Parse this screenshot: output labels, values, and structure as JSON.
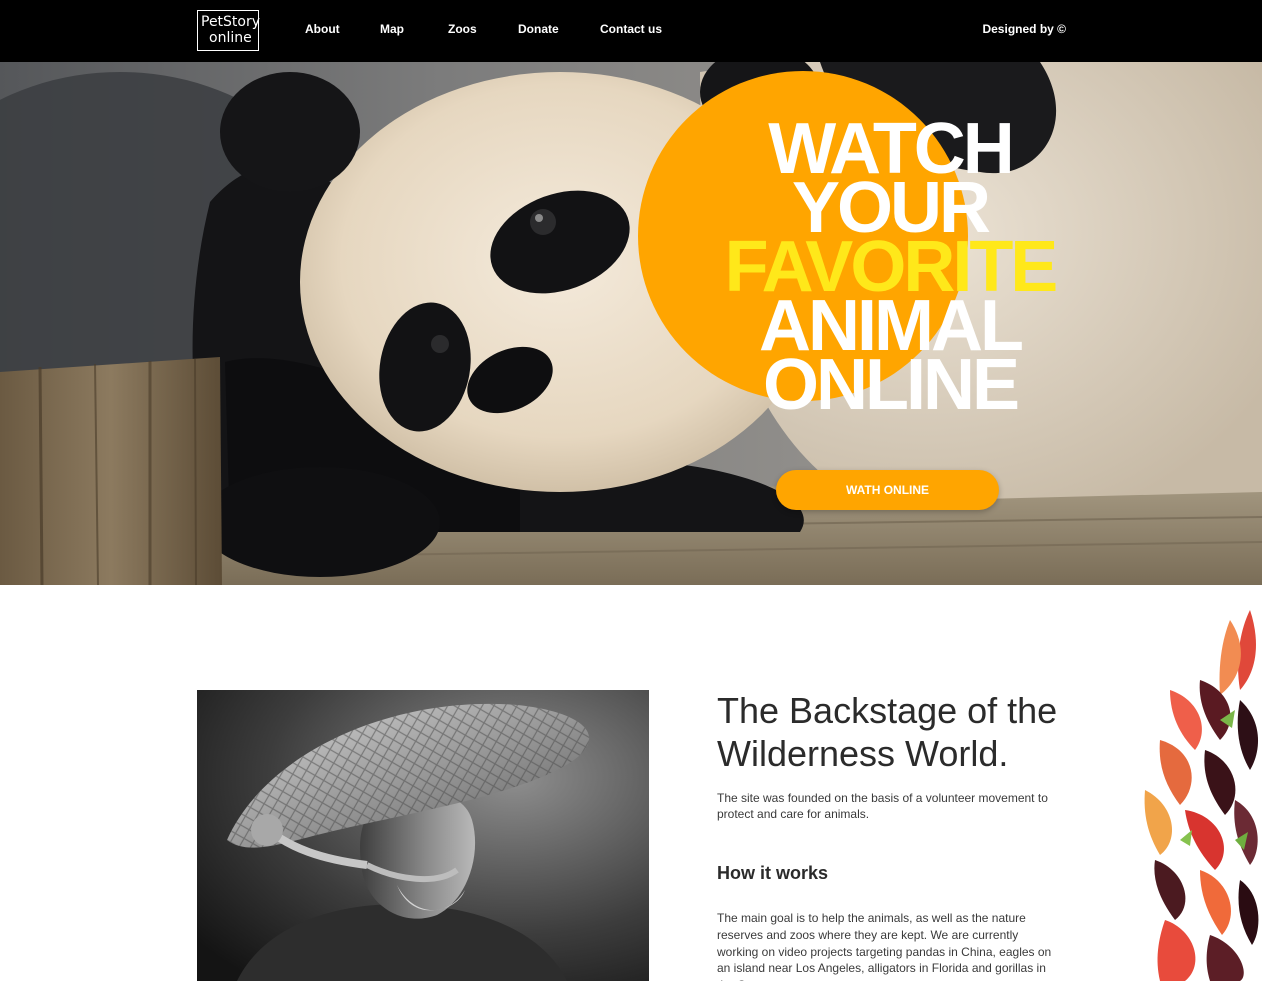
{
  "brand": {
    "logo_line1": "PetStory",
    "logo_line2": "online"
  },
  "nav": {
    "items": [
      {
        "label": "About"
      },
      {
        "label": "Map"
      },
      {
        "label": "Zoos"
      },
      {
        "label": "Donate"
      },
      {
        "label": "Contact us"
      }
    ],
    "credit": "Designed by ©"
  },
  "hero": {
    "headline_line1": "WATCH",
    "headline_line2": "YOUR",
    "headline_line3": "FAVORITE",
    "headline_line4": "ANIMAL",
    "headline_line5": "ONLINE",
    "cta_label": "WATH ONLINE"
  },
  "about": {
    "title_line1": "The Backstage of the",
    "title_line2": "Wilderness World.",
    "intro": "The site was founded on the basis of a volunteer movement to protect and care for animals.",
    "how_title": "How it works",
    "how_text": "The main goal is to help the animals, as well as the nature reserves and zoos where they are kept. We are currently working on video projects targeting pandas in China, eagles on an island near Los Angeles, alligators in Florida and gorillas in the Congo."
  },
  "colors": {
    "nav_background": "#000000",
    "accent_orange": "#ffa500",
    "headline_yellow": "#ffe81a",
    "text_dark": "#2b2b2b"
  },
  "icons": {
    "hero_image": "panda-photo",
    "about_image": "old-man-straw-hat-photo",
    "decoration": "autumn-leaves-image"
  }
}
